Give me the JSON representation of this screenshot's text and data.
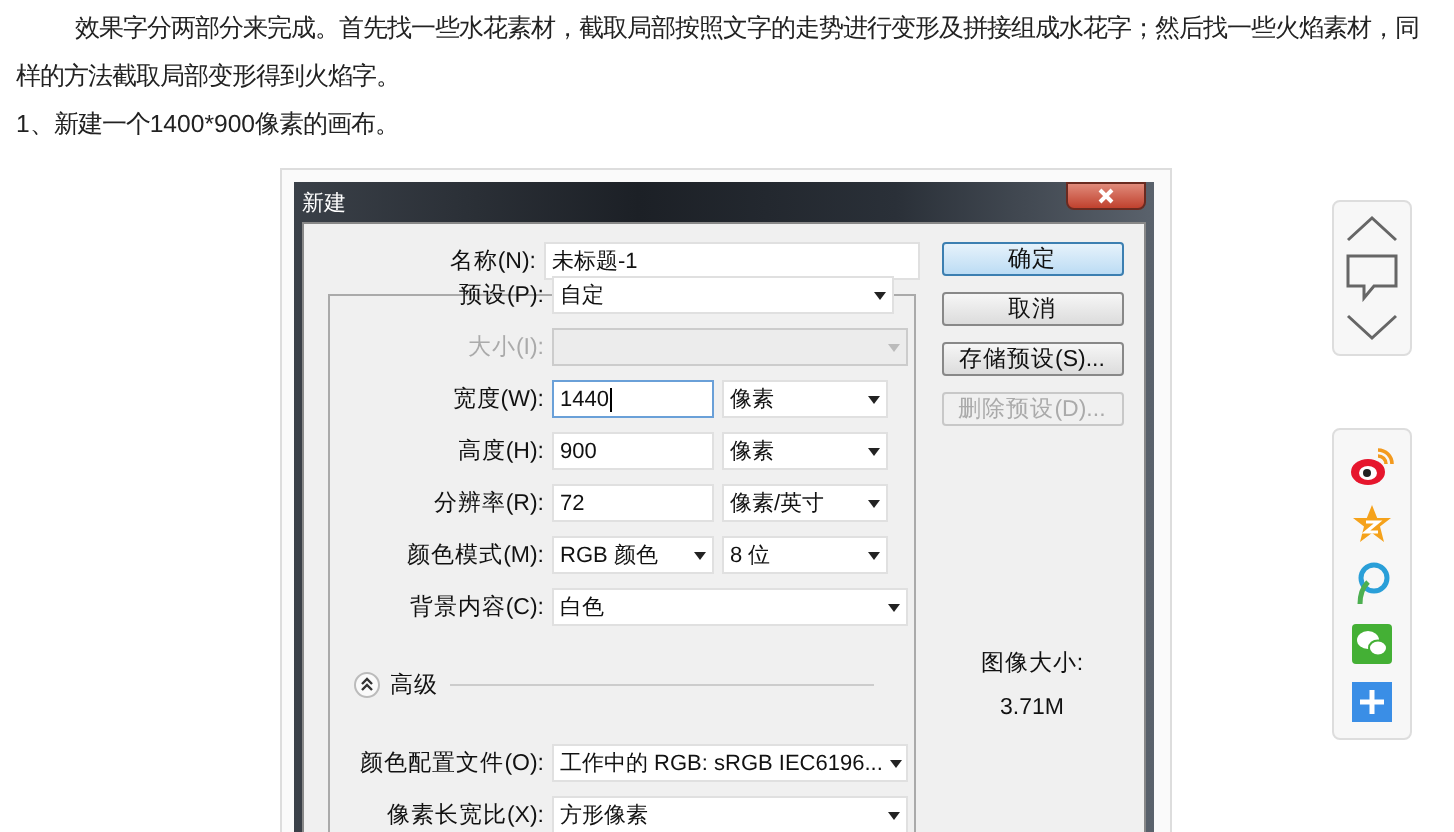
{
  "article": {
    "paragraphs": [
      {
        "text": "效果字分两部分来完成。首先找一些水花素材，截取局部按照文字的走势进行变形及拼接组成水花字；然后找一些火焰素材，同样的方法截取局部变形得到火焰字。",
        "indent": true
      },
      {
        "text": "1、新建一个1400*900像素的画布。",
        "indent": false
      }
    ]
  },
  "dialog": {
    "title": "新建",
    "fields": [
      {
        "label": "名称(N):",
        "disabled": false,
        "focused": false,
        "control": {
          "kind": "input",
          "value": "未标题-1"
        }
      },
      {
        "label": "预设(P):",
        "disabled": false,
        "focused": false,
        "control": {
          "kind": "select",
          "value": "自定"
        }
      },
      {
        "label": "大小(I):",
        "disabled": true,
        "focused": false,
        "control": {
          "kind": "select"
        }
      },
      {
        "label": "宽度(W):",
        "disabled": false,
        "focused": true,
        "control": {
          "kind": "input",
          "value": "1440"
        },
        "unit": {
          "kind": "select",
          "value": "像素"
        }
      },
      {
        "label": "高度(H):",
        "disabled": false,
        "focused": false,
        "control": {
          "kind": "input",
          "value": "900"
        },
        "unit": {
          "kind": "select",
          "value": "像素"
        }
      },
      {
        "label": "分辨率(R):",
        "disabled": false,
        "focused": false,
        "control": {
          "kind": "input",
          "value": "72"
        },
        "unit": {
          "kind": "select",
          "value": "像素/英寸"
        }
      },
      {
        "label": "颜色模式(M):",
        "disabled": false,
        "focused": false,
        "control": {
          "kind": "select",
          "value": "RGB 颜色"
        },
        "unit": {
          "kind": "select",
          "value": "8 位"
        }
      },
      {
        "label": "背景内容(C):",
        "disabled": false,
        "focused": false,
        "control": {
          "kind": "select",
          "value": "白色"
        }
      }
    ],
    "advanced": {
      "label": "高级",
      "expanded": true
    },
    "advanced_fields": [
      {
        "label": "颜色配置文件(O):",
        "disabled": false,
        "focused": false,
        "control": {
          "kind": "select",
          "value": "工作中的 RGB: sRGB IEC6196..."
        }
      },
      {
        "label": "像素长宽比(X):",
        "disabled": false,
        "focused": false,
        "control": {
          "kind": "select",
          "value": "方形像素"
        }
      }
    ],
    "buttons": [
      {
        "label": "确定",
        "default": true,
        "disabled": false
      },
      {
        "label": "取消",
        "default": false,
        "disabled": false
      },
      {
        "label": "存储预设(S)...",
        "default": false,
        "disabled": false
      },
      {
        "label": "删除预设(D)...",
        "default": false,
        "disabled": true
      }
    ],
    "image_size": {
      "label": "图像大小:",
      "value": "3.71M"
    }
  }
}
